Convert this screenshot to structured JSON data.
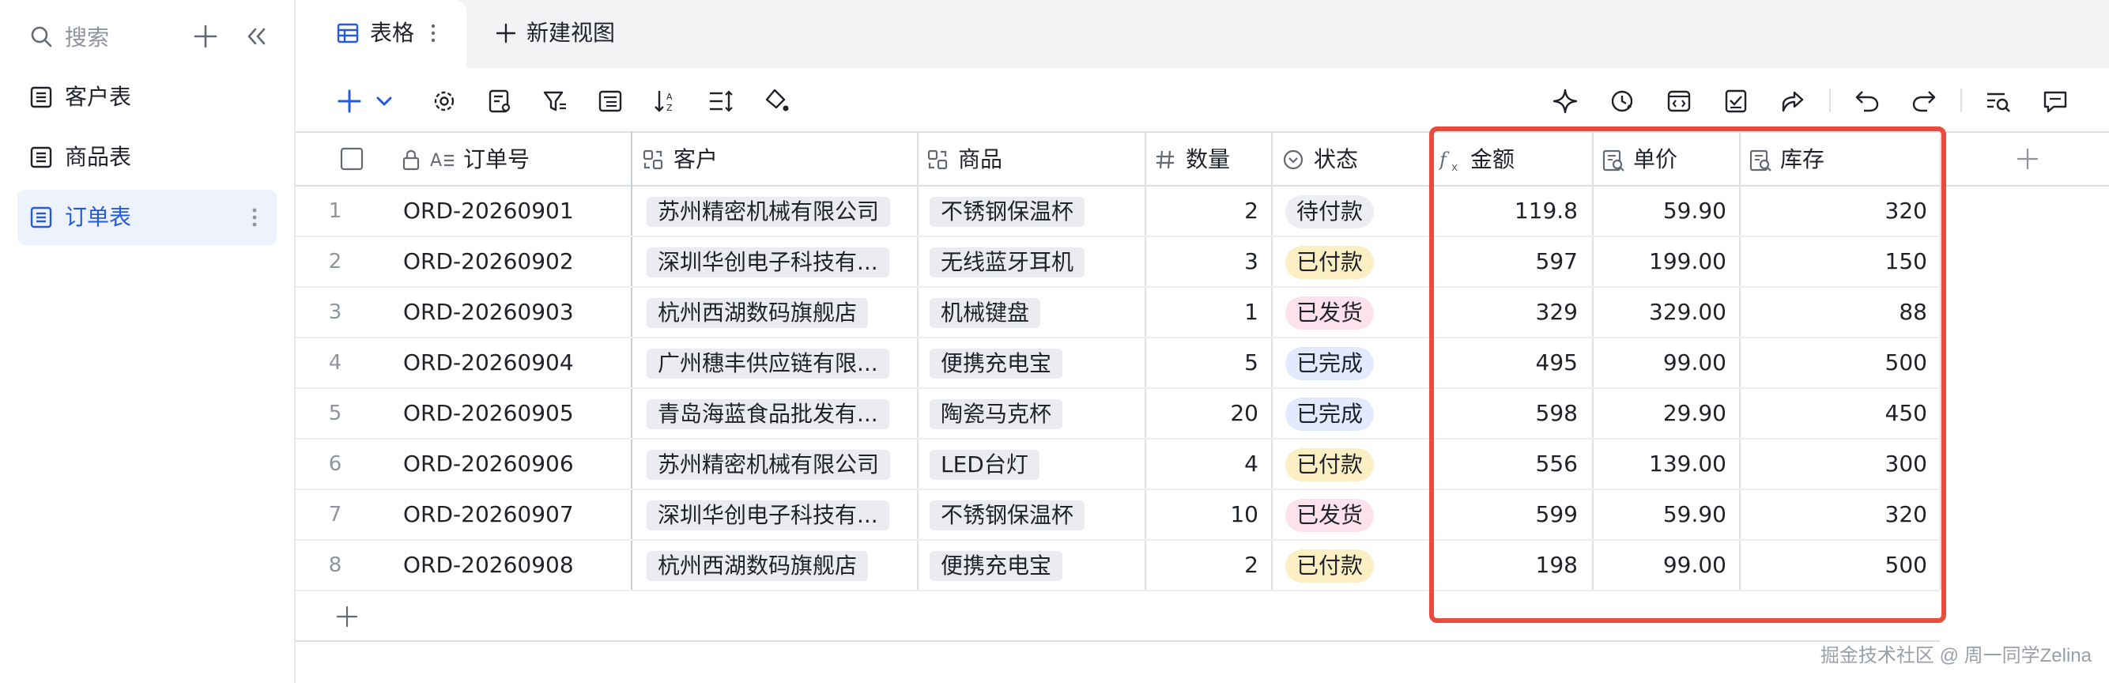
{
  "sidebar": {
    "search_placeholder": "搜索",
    "items": [
      {
        "label": "客户表"
      },
      {
        "label": "商品表"
      },
      {
        "label": "订单表"
      }
    ]
  },
  "tabs": {
    "active_label": "表格",
    "new_view_label": "新建视图"
  },
  "columns": {
    "order_no": "订单号",
    "customer": "客户",
    "product": "商品",
    "quantity": "数量",
    "status": "状态",
    "amount": "金额",
    "unit_price": "单价",
    "stock": "库存"
  },
  "rows": [
    {
      "n": "1",
      "order_no": "ORD-20260901",
      "customer": "苏州精密机械有限公司",
      "product": "不锈钢保温杯",
      "quantity": "2",
      "status": "待付款",
      "amount": "119.8",
      "unit_price": "59.90",
      "stock": "320"
    },
    {
      "n": "2",
      "order_no": "ORD-20260902",
      "customer": "深圳华创电子科技有...",
      "product": "无线蓝牙耳机",
      "quantity": "3",
      "status": "已付款",
      "amount": "597",
      "unit_price": "199.00",
      "stock": "150"
    },
    {
      "n": "3",
      "order_no": "ORD-20260903",
      "customer": "杭州西湖数码旗舰店",
      "product": "机械键盘",
      "quantity": "1",
      "status": "已发货",
      "amount": "329",
      "unit_price": "329.00",
      "stock": "88"
    },
    {
      "n": "4",
      "order_no": "ORD-20260904",
      "customer": "广州穗丰供应链有限...",
      "product": "便携充电宝",
      "quantity": "5",
      "status": "已完成",
      "amount": "495",
      "unit_price": "99.00",
      "stock": "500"
    },
    {
      "n": "5",
      "order_no": "ORD-20260905",
      "customer": "青岛海蓝食品批发有...",
      "product": "陶瓷马克杯",
      "quantity": "20",
      "status": "已完成",
      "amount": "598",
      "unit_price": "29.90",
      "stock": "450"
    },
    {
      "n": "6",
      "order_no": "ORD-20260906",
      "customer": "苏州精密机械有限公司",
      "product": "LED台灯",
      "quantity": "4",
      "status": "已付款",
      "amount": "556",
      "unit_price": "139.00",
      "stock": "300"
    },
    {
      "n": "7",
      "order_no": "ORD-20260907",
      "customer": "深圳华创电子科技有...",
      "product": "不锈钢保温杯",
      "quantity": "10",
      "status": "已发货",
      "amount": "599",
      "unit_price": "59.90",
      "stock": "320"
    },
    {
      "n": "8",
      "order_no": "ORD-20260908",
      "customer": "杭州西湖数码旗舰店",
      "product": "便携充电宝",
      "quantity": "2",
      "status": "已付款",
      "amount": "198",
      "unit_price": "99.00",
      "stock": "500"
    }
  ],
  "status_colors": {
    "待付款": {
      "bg": "#eceef1",
      "fg": "#1f2329"
    },
    "已付款": {
      "bg": "#fcefc4",
      "fg": "#1f2329"
    },
    "已发货": {
      "bg": "#fde2ee",
      "fg": "#1f2329"
    },
    "已完成": {
      "bg": "#e1eaff",
      "fg": "#1f2329"
    }
  },
  "highlight_color": "#e74c3c",
  "watermark": "掘金技术社区 @ 周一同学Zelina"
}
